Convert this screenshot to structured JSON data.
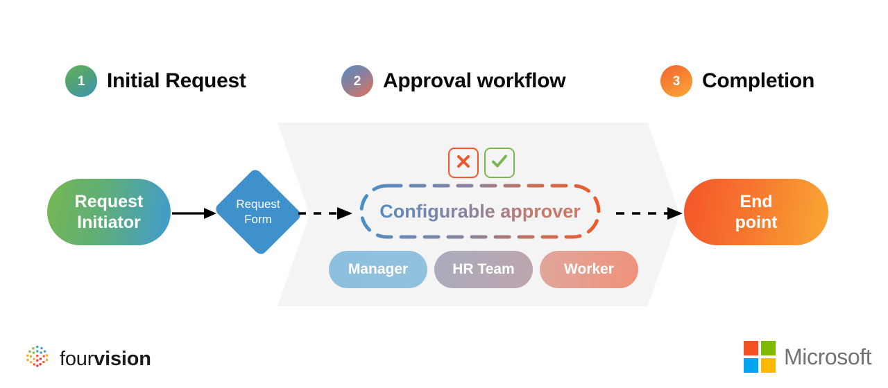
{
  "steps": [
    {
      "number": "1",
      "label": "Initial Request",
      "color_from": "#63b157",
      "color_to": "#3f95b5"
    },
    {
      "number": "2",
      "label": "Approval workflow",
      "color_from": "#5a8fc4",
      "color_to": "#e0735a"
    },
    {
      "number": "3",
      "label": "Completion",
      "color_from": "#f4622e",
      "color_to": "#f9a939"
    }
  ],
  "flow": {
    "initiator": {
      "line1": "Request",
      "line2": "Initiator",
      "color_from": "#76b852",
      "color_to": "#3f9bd1"
    },
    "request_form": {
      "line1": "Request",
      "line2": "Form",
      "color": "#3f91cc"
    },
    "approver": {
      "label": "Configurable approver",
      "border_from": "#4a8fc7",
      "border_to": "#ef5a2b"
    },
    "decision": {
      "reject": {
        "icon": "cross-icon",
        "color": "#f2552c"
      },
      "approve": {
        "icon": "check-icon",
        "color": "#7ab84f"
      }
    },
    "roles": [
      {
        "label": "Manager",
        "color": "#8cc0de"
      },
      {
        "label": "HR Team",
        "color": "#aeaabb"
      },
      {
        "label": "Worker",
        "color": "#e79c8b"
      }
    ],
    "end_point": {
      "line1": "End",
      "line2": "point",
      "color_from": "#f4552a",
      "color_to": "#f9a833"
    },
    "band_color": "#f4f4f4",
    "arrow_color": "#000000"
  },
  "footer": {
    "fourvision": {
      "text_light": "four",
      "text_bold": "vision",
      "mark": "dot-burst-icon"
    },
    "microsoft": {
      "text": "Microsoft",
      "squares": [
        "#f25022",
        "#7fba00",
        "#00a4ef",
        "#ffb900"
      ]
    }
  }
}
